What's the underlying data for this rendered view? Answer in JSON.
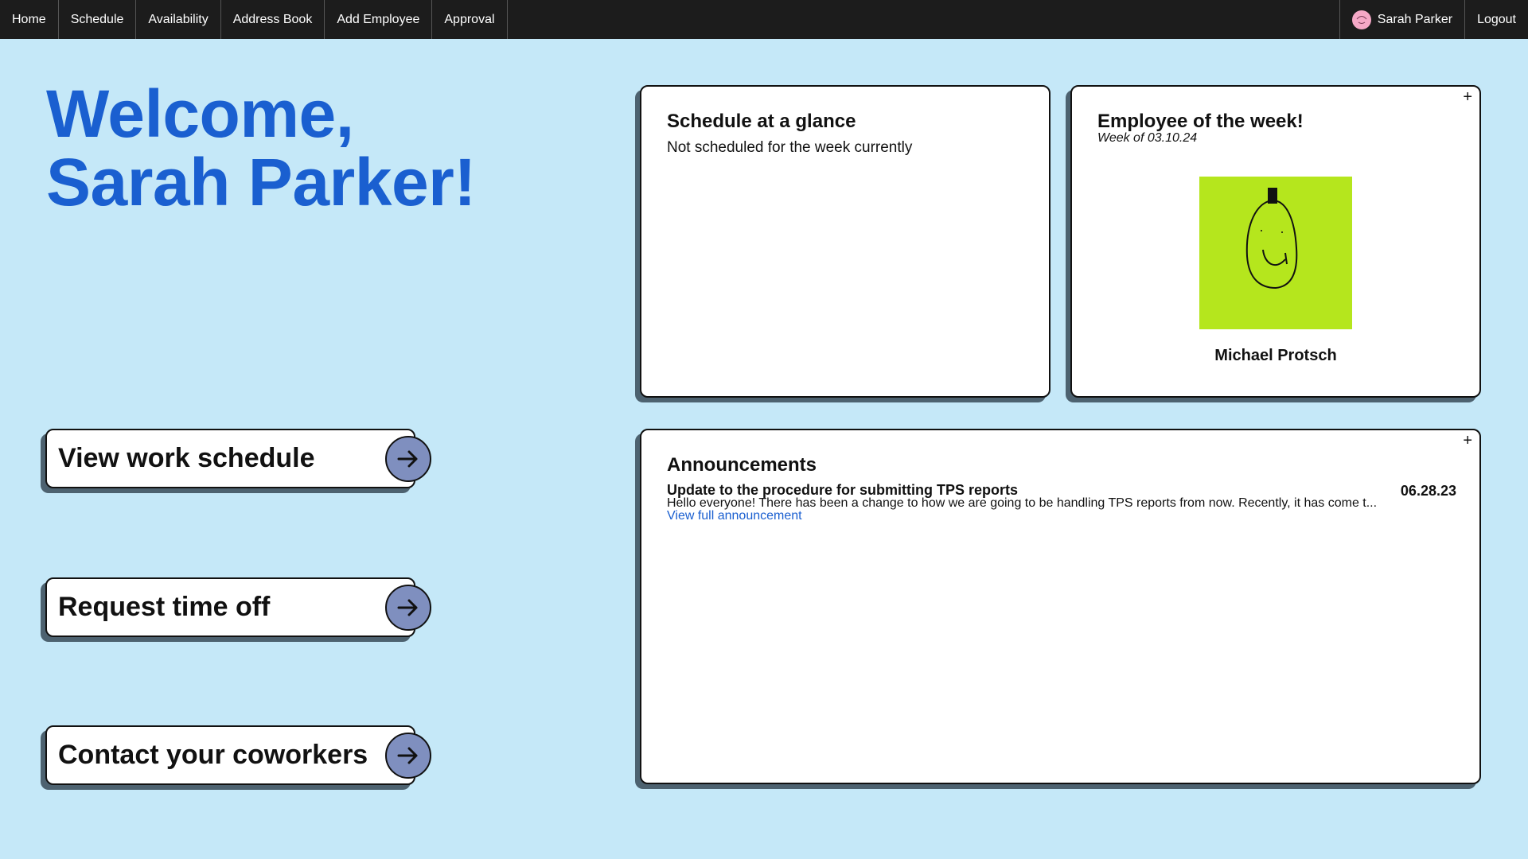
{
  "nav": {
    "items": [
      {
        "label": "Home"
      },
      {
        "label": "Schedule"
      },
      {
        "label": "Availability"
      },
      {
        "label": "Address Book"
      },
      {
        "label": "Add Employee"
      },
      {
        "label": "Approval"
      }
    ],
    "user_name": "Sarah Parker",
    "logout_label": "Logout"
  },
  "welcome": {
    "line1": "Welcome,",
    "line2": "Sarah Parker!"
  },
  "actions": [
    {
      "label": "View work schedule",
      "icon": "arrow-right-icon"
    },
    {
      "label": "Request time off",
      "icon": "arrow-right-icon"
    },
    {
      "label": "Contact your coworkers",
      "icon": "arrow-right-icon"
    }
  ],
  "schedule_card": {
    "title": "Schedule at a glance",
    "text": "Not scheduled for the week currently"
  },
  "eotw_card": {
    "title": "Employee of the week!",
    "week": "Week of 03.10.24",
    "name": "Michael Protsch",
    "photo_bg": "#b5e61d",
    "add_label": "+"
  },
  "announcements": {
    "title": "Announcements",
    "add_label": "+",
    "items": [
      {
        "title": "Update to the procedure for submitting TPS reports",
        "date": "06.28.23",
        "body": "Hello everyone! There has been a change to how we are going to be handling TPS reports from now. Recently, it has come t...",
        "link": "View full announcement"
      }
    ]
  },
  "colors": {
    "background": "#c5e8f8",
    "navbar": "#1c1c1c",
    "accent": "#1a5fd0",
    "button_circle": "#7f8fbf",
    "shadow": "#4d6270"
  }
}
